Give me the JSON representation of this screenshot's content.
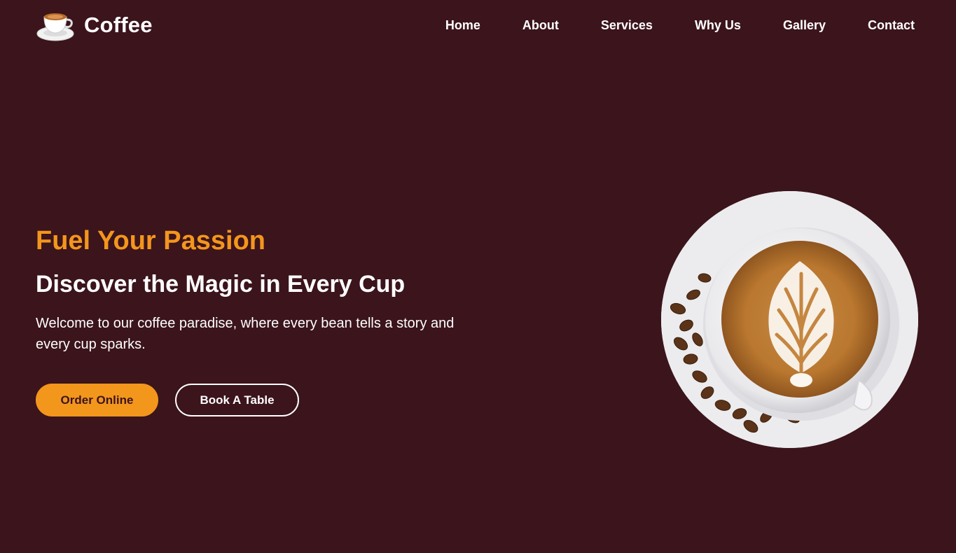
{
  "header": {
    "logo_text": "Coffee",
    "logo_icon": "coffee-cup-icon",
    "nav": [
      {
        "label": "Home"
      },
      {
        "label": "About"
      },
      {
        "label": "Services"
      },
      {
        "label": "Why Us"
      },
      {
        "label": "Gallery"
      },
      {
        "label": "Contact"
      }
    ]
  },
  "hero": {
    "subtitle": "Fuel Your Passion",
    "title": "Discover the Magic in Every Cup",
    "description": "Welcome to our coffee paradise, where every bean tells a story and every cup sparks.",
    "buttons": {
      "order": "Order Online",
      "book": "Book A Table"
    },
    "image": "latte-art-coffee-cup"
  },
  "colors": {
    "background": "#3b141c",
    "accent": "#f3961c",
    "text": "#ffffff"
  }
}
